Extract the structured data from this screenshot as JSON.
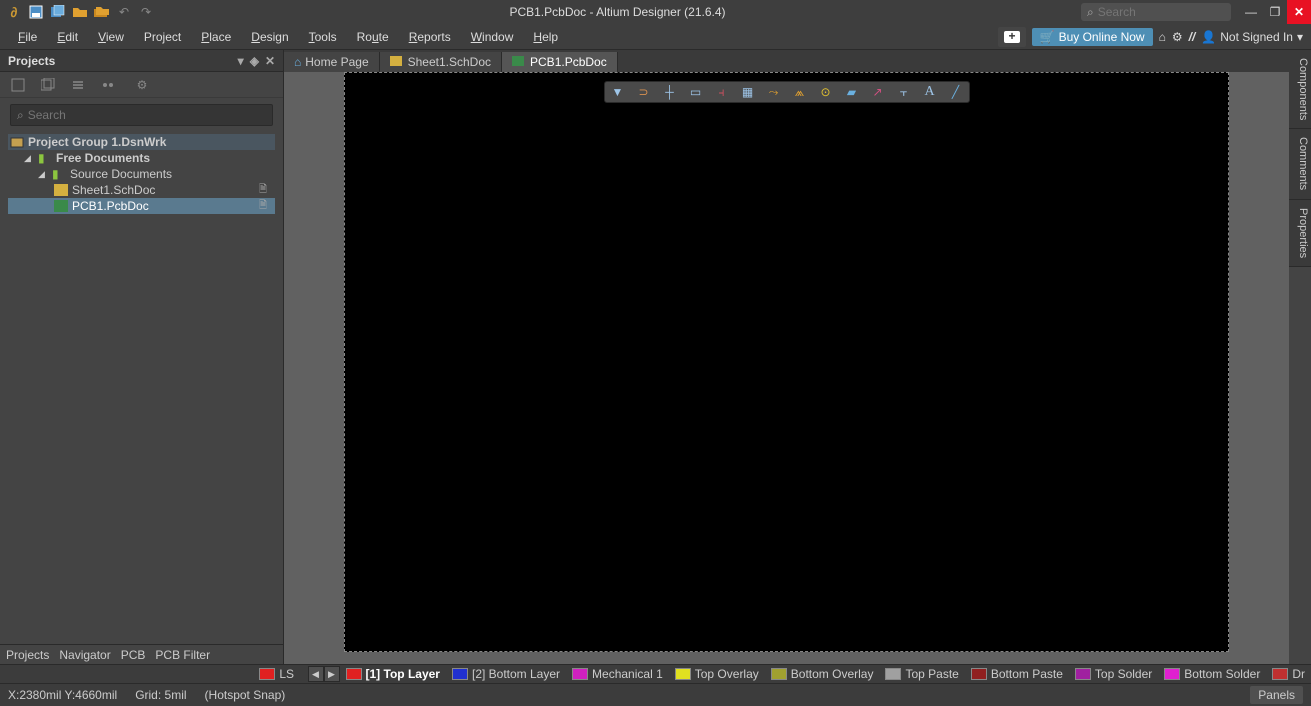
{
  "title": "PCB1.PcbDoc - Altium Designer (21.6.4)",
  "search_placeholder": "Search",
  "menu": {
    "file": "File",
    "edit": "Edit",
    "view": "View",
    "project": "Project",
    "place": "Place",
    "design": "Design",
    "tools": "Tools",
    "route": "Route",
    "reports": "Reports",
    "window": "Window",
    "help": "Help"
  },
  "buy": "Buy Online Now",
  "signin": "Not Signed In",
  "panel": {
    "title": "Projects",
    "search_placeholder": "Search",
    "group": "Project Group 1.DsnWrk",
    "free_docs": "Free Documents",
    "source_docs": "Source Documents",
    "sheet1": "Sheet1.SchDoc",
    "pcb1": "PCB1.PcbDoc",
    "btab_projects": "Projects",
    "btab_navigator": "Navigator",
    "btab_pcb": "PCB",
    "btab_filter": "PCB Filter"
  },
  "tabs": {
    "home": "Home Page",
    "sheet1": "Sheet1.SchDoc",
    "pcb1": "PCB1.PcbDoc"
  },
  "right_tabs": {
    "components": "Components",
    "comments": "Comments",
    "properties": "Properties"
  },
  "layers": {
    "ls": "LS",
    "top": "[1] Top Layer",
    "bottom": "[2] Bottom Layer",
    "mech1": "Mechanical 1",
    "top_overlay": "Top Overlay",
    "bot_overlay": "Bottom Overlay",
    "top_paste": "Top Paste",
    "bot_paste": "Bottom Paste",
    "top_solder": "Top Solder",
    "bot_solder": "Bottom Solder",
    "drill": "Dr"
  },
  "status": {
    "coords": "X:2380mil Y:4660mil",
    "grid": "Grid: 5mil",
    "snap": "(Hotspot Snap)",
    "panels": "Panels"
  }
}
